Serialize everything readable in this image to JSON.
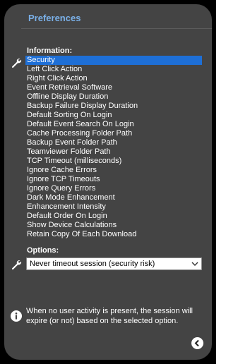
{
  "header": {
    "title": "Preferences"
  },
  "information": {
    "label": "Information:",
    "items": [
      "Security",
      "Left Click Action",
      "Right Click Action",
      "Event Retrieval Software",
      "Offline Display Duration",
      "Backup Failure Display Duration",
      "Default Sorting On Login",
      "Default Event Search On Login",
      "Cache Processing Folder Path",
      "Backup Event Folder Path",
      "Teamviewer Folder Path",
      "TCP Timeout (milliseconds)",
      "Ignore Cache Errors",
      "Ignore TCP Timeouts",
      "Ignore Query Errors",
      "Dark Mode Enhancement",
      "Enhancement Intensity",
      "Default Order On Login",
      "Show Device Calculations",
      "Retain Copy Of Each Download"
    ],
    "selected": "Security"
  },
  "options": {
    "label": "Options:",
    "selected_value": "Never timeout session (security risk)"
  },
  "info_note": "When no user activity is present, the session will expire (or not) based on the selected option.",
  "icons": {
    "settings": "wrench-icon",
    "info": "info-icon",
    "back": "back-chevron-icon"
  },
  "colors": {
    "panel": "#444444",
    "title": "#7ab0e8",
    "selection": "#1e6fd6"
  }
}
